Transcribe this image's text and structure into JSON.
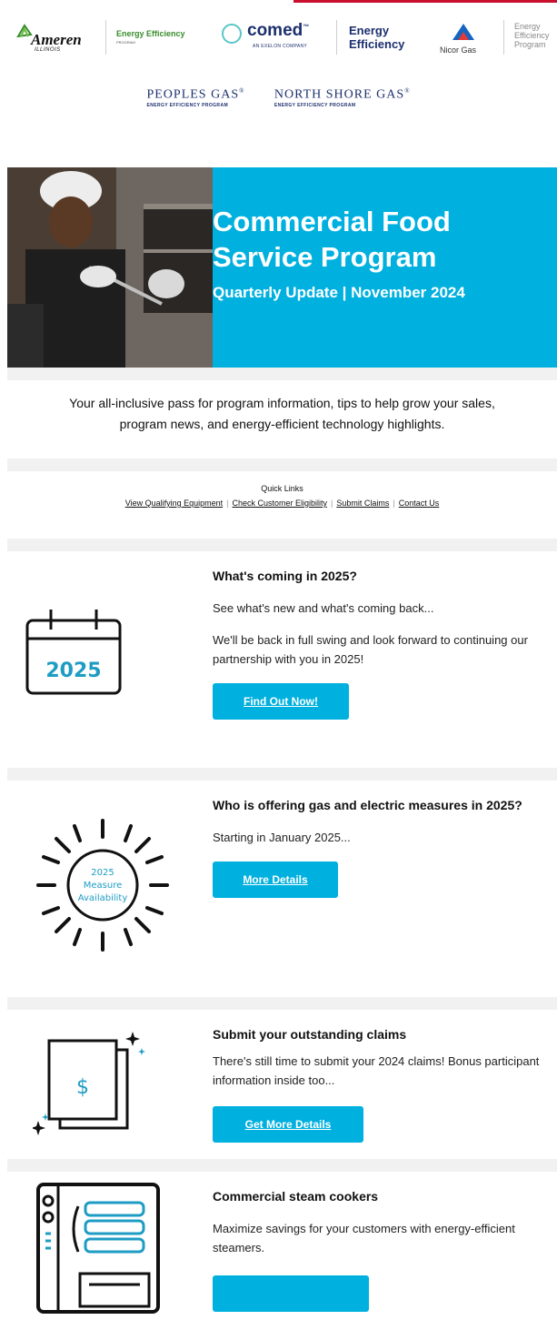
{
  "logos": {
    "ameren": "Ameren",
    "ameren_sub": "ILLINOIS",
    "ameren_program": "Energy Efficiency",
    "ameren_program_sub": "PROGRAM",
    "comed": "comed",
    "comed_tm": "™",
    "comed_sub": "AN EXELON COMPANY",
    "comed_program_1": "Energy",
    "comed_program_2": "Efficiency",
    "nicor": "Nicor Gas",
    "nicor_program_1": "Energy",
    "nicor_program_2": "Efficiency",
    "nicor_program_3": "Program",
    "peoples": "PEOPLES GAS",
    "peoples_sub": "ENERGY EFFICIENCY PROGRAM",
    "northshore": "NORTH SHORE GAS",
    "northshore_sub": "ENERGY EFFICIENCY PROGRAM",
    "registered": "®"
  },
  "hero": {
    "title_line1": "Commercial Food",
    "title_line2": "Service Program",
    "subtitle": "Quarterly Update | November 2024"
  },
  "intro": {
    "line1": "Your all-inclusive pass for program information, tips to help grow your sales,",
    "line2": "program news, and energy-efficient technology highlights."
  },
  "quick_links": {
    "title": "Quick Links",
    "links": [
      "View Qualifying Equipment",
      "Check Customer Eligibility",
      "Submit Claims",
      "Contact Us"
    ],
    "separator": "|"
  },
  "sections": [
    {
      "title": "What's coming in 2025?",
      "paragraphs": [
        "See what's new and what's coming back...",
        "We'll be back in full swing and look forward to continuing our partnership with you in 2025!"
      ],
      "button": "Find Out Now!",
      "icon_text": "2025"
    },
    {
      "title": "Who is offering gas and electric measures in 2025?",
      "paragraphs": [
        "Starting in January 2025..."
      ],
      "button": "More Details",
      "icon_text_1": "2025",
      "icon_text_2": "Measure",
      "icon_text_3": "Availability"
    },
    {
      "title": "Submit your outstanding claims",
      "paragraphs": [
        "There's still time to submit your 2024 claims! Bonus participant information inside too..."
      ],
      "button": "Get More Details",
      "icon_text": "$"
    },
    {
      "title": "Commercial steam cookers",
      "paragraphs": [
        "Maximize savings for your customers with energy-efficient steamers."
      ],
      "button": ""
    }
  ],
  "colors": {
    "accent": "#00b0df",
    "band": "#f1f1f1",
    "navy": "#1c2f6e",
    "green": "#3a8d2e"
  }
}
